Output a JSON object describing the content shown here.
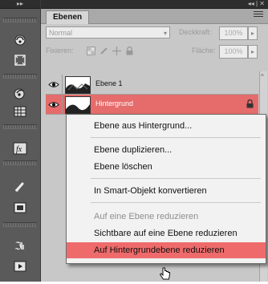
{
  "panel": {
    "tab_label": "Ebenen",
    "blend_mode": "Normal",
    "opacity_label": "Deckkraft:",
    "opacity_value": "100%",
    "lock_label": "Fixieren:",
    "fill_label": "Fläche:",
    "fill_value": "100%"
  },
  "layers": [
    {
      "name": "Ebene 1",
      "visible": true,
      "selected": false
    },
    {
      "name": "Hintergrund",
      "visible": true,
      "selected": true
    }
  ],
  "context_menu": {
    "items": [
      {
        "label": "Ebene aus Hintergrund...",
        "enabled": true
      },
      {
        "label": "Ebene duplizieren...",
        "enabled": true
      },
      {
        "label": "Ebene löschen",
        "enabled": true
      },
      {
        "label": "In Smart-Objekt konvertieren",
        "enabled": true
      },
      {
        "label": "Auf eine Ebene reduzieren",
        "enabled": false
      },
      {
        "label": "Sichtbare auf eine Ebene reduzieren",
        "enabled": true
      },
      {
        "label": "Auf Hintergrundebene reduzieren",
        "enabled": true,
        "highlighted": true
      }
    ]
  },
  "colors": {
    "selected_layer": "#e66b6b",
    "menu_highlight": "#ef6b6b",
    "panel_bg": "#c8c8c8",
    "tool_bg": "#5a5a5a"
  },
  "icons": {
    "tools": [
      "3d-rotate-icon",
      "3d-orbit-icon",
      "3d-camera-icon",
      "grid-icon",
      "fx-icon",
      "brush-icon",
      "mask-icon",
      "adjust-icon",
      "play-icon"
    ]
  }
}
